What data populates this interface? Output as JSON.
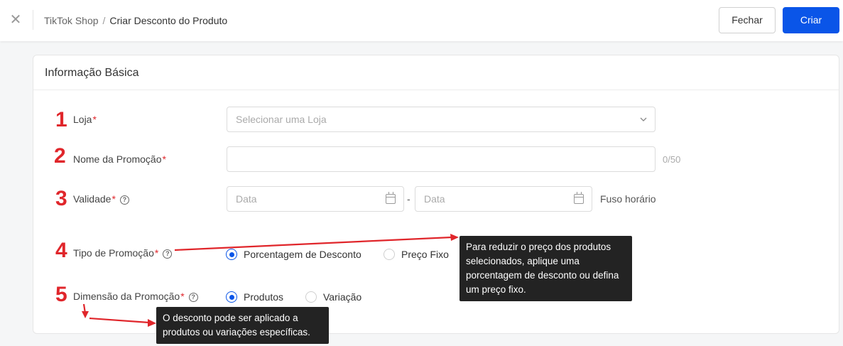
{
  "header": {
    "close_icon": "close-icon",
    "breadcrumb": {
      "root": "TikTok Shop",
      "separator": "/",
      "current": "Criar Desconto do Produto"
    },
    "close_button": "Fechar",
    "create_button": "Criar",
    "accent_color": "#0a55e8"
  },
  "card": {
    "title": "Informação Básica",
    "fields": {
      "store": {
        "number": "1",
        "label": "Loja",
        "required": "*",
        "placeholder": "Selecionar uma Loja"
      },
      "promo_name": {
        "number": "2",
        "label": "Nome da Promoção",
        "required": "*",
        "value": "",
        "counter": "0/50"
      },
      "validity": {
        "number": "3",
        "label": "Validade",
        "required": "*",
        "start_placeholder": "Data",
        "dash": "-",
        "end_placeholder": "Data",
        "timezone": "Fuso horário"
      },
      "promo_type": {
        "number": "4",
        "label": "Tipo de Promoção",
        "required": "*",
        "options": [
          "Porcentagem de Desconto",
          "Preço Fixo"
        ],
        "selected": "Porcentagem de Desconto"
      },
      "promo_dimension": {
        "number": "5",
        "label": "Dimensão da Promoção",
        "required": "*",
        "options": [
          "Produtos",
          "Variação"
        ],
        "selected": "Produtos"
      }
    }
  },
  "tooltips": {
    "promo_type": "Para reduzir o preço dos produtos selecionados, aplique uma porcentagem de desconto ou defina um preço fixo.",
    "promo_dimension": "O desconto pode ser aplicado a produtos ou variações específicas."
  },
  "annotation_color": "#e0262b"
}
